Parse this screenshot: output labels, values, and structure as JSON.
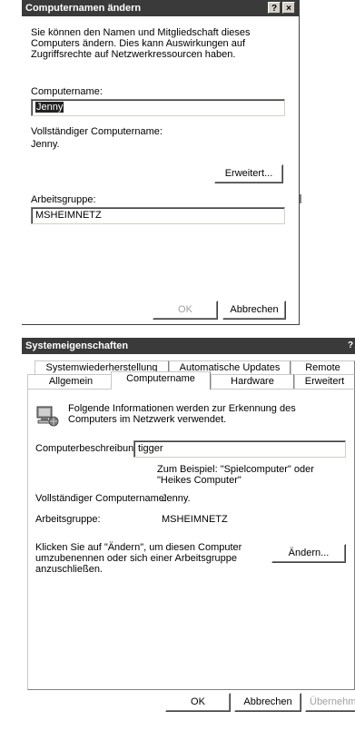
{
  "dialog1": {
    "title": "Computernamen ändern",
    "help_btn": "?",
    "close_btn": "×",
    "description": "Sie können den Namen und Mitgliedschaft dieses Computers ändern. Dies kann Auswirkungen auf Zugriffsrechte auf Netzwerkressourcen haben.",
    "computer_name_label": "Computername:",
    "computer_name_value": "Jenny",
    "full_name_label": "Vollständiger Computername:",
    "full_name_value": "Jenny.",
    "advanced_btn": "Erweitert...",
    "workgroup_label": "Arbeitsgruppe:",
    "workgroup_value": "MSHEIMNETZ",
    "ok_btn": "OK",
    "cancel_btn": "Abbrechen"
  },
  "dialog2": {
    "title": "Systemeigenschaften",
    "help_btn": "?",
    "tabs_row1": [
      "Systemwiederherstellung",
      "Automatische Updates",
      "Remote"
    ],
    "tabs_row2": [
      "Allgemein",
      "Computername",
      "Hardware",
      "Erweitert"
    ],
    "active_tab": "Computername",
    "info": "Folgende Informationen werden zur Erkennung des Computers im Netzwerk verwendet.",
    "description_label": "Computerbeschreibung:",
    "description_value": "tigger",
    "example_text": "Zum Beispiel: \"Spielcomputer\" oder \"Heikes Computer\"",
    "full_name_label": "Vollständiger Computername:",
    "full_name_value": "Jenny.",
    "workgroup_label": "Arbeitsgruppe:",
    "workgroup_value": "MSHEIMNETZ",
    "change_text": "Klicken Sie auf \"Ändern\", um diesen Computer umzubenennen oder sich einer Arbeitsgruppe anzuschließen.",
    "change_btn": "Ändern...",
    "ok_btn": "OK",
    "cancel_btn": "Abbrechen",
    "apply_btn": "Übernehmen"
  }
}
